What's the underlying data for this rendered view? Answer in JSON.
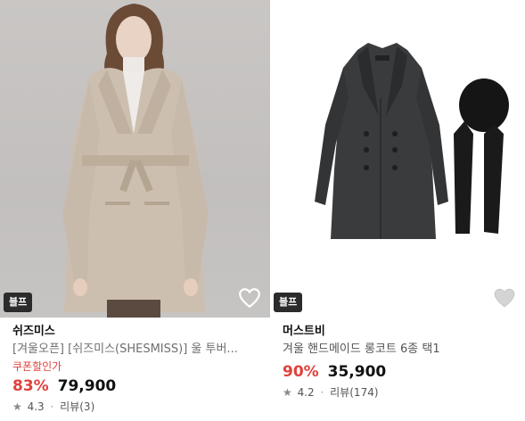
{
  "products": [
    {
      "badge": "블프",
      "brand": "쉬즈미스",
      "title": "[겨울오픈] [쉬즈미스(SHESMISS)] 울 투버...",
      "coupon": "쿠폰할인가",
      "discount": "83%",
      "price": "79,900",
      "rating": "4.3",
      "review_text": "리뷰(3)",
      "heart_icon": "heart-outline-icon"
    },
    {
      "badge": "블프",
      "brand": "머스트비",
      "title": "겨울 핸드메이드 롱코트 6종 택1",
      "discount": "90%",
      "price": "35,900",
      "rating": "4.2",
      "review_text": "리뷰(174)",
      "heart_icon": "heart-filled-icon"
    }
  ],
  "colors": {
    "discount": "#e0413c",
    "badge_bg": "#2b2b2b"
  }
}
